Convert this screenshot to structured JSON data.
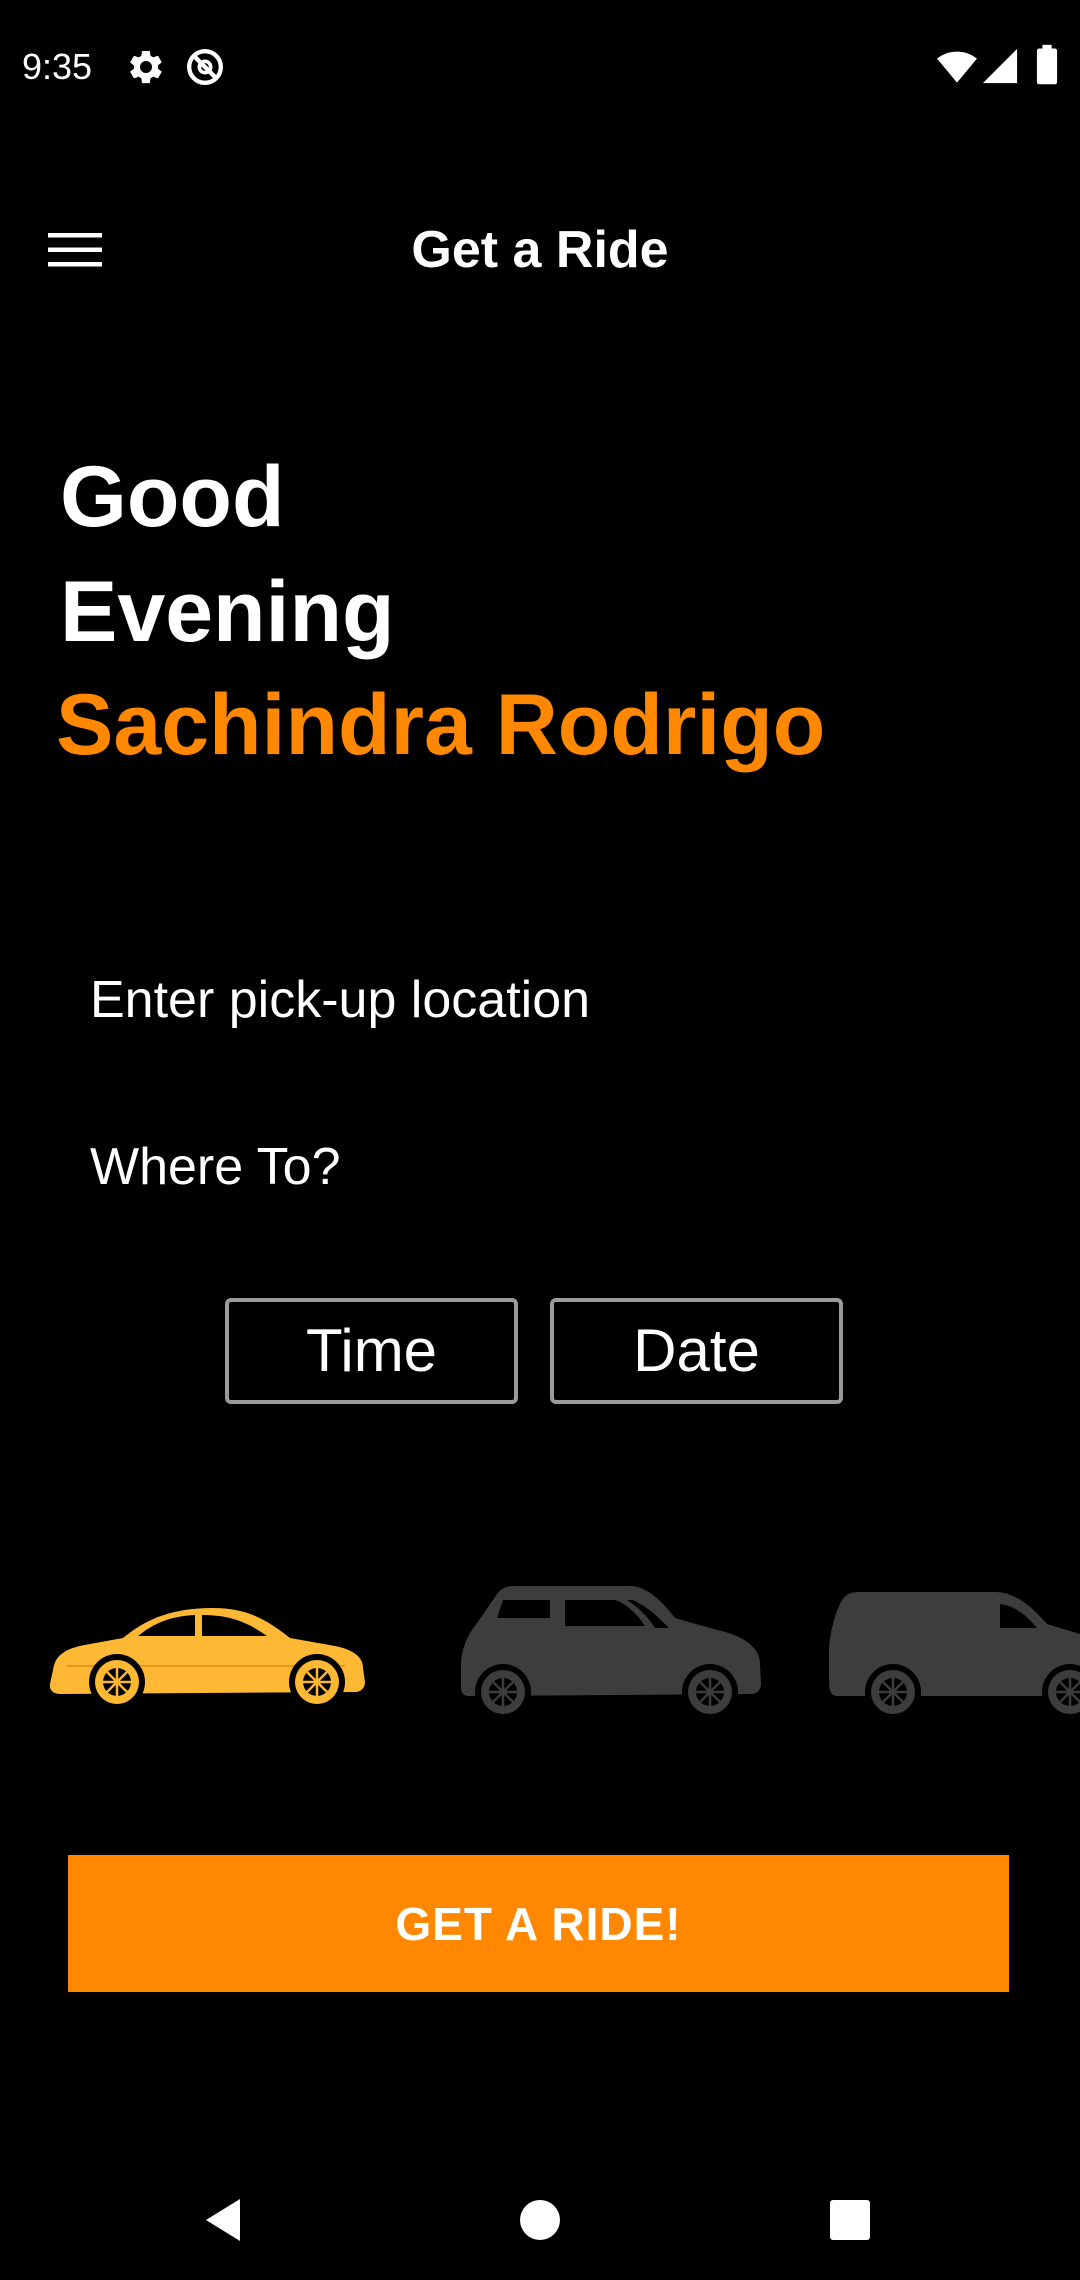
{
  "status_bar": {
    "time": "9:35",
    "icons": [
      "settings-icon",
      "do-not-disturb-icon",
      "wifi-icon",
      "cellular-signal-icon",
      "battery-icon"
    ]
  },
  "app_bar": {
    "menu_icon": "hamburger-menu-icon",
    "title": "Get a Ride"
  },
  "greeting": {
    "line1": "Good",
    "line2": "Evening",
    "user_name": "Sachindra Rodrigo"
  },
  "form": {
    "pickup_placeholder": "Enter pick-up location",
    "pickup_value": "",
    "destination_placeholder": "Where To?",
    "destination_value": "",
    "time_label": "Time",
    "date_label": "Date"
  },
  "vehicles": [
    {
      "type": "sedan",
      "selected": true,
      "icon": "sedan-car-icon"
    },
    {
      "type": "hatchback",
      "selected": false,
      "icon": "hatchback-car-icon"
    },
    {
      "type": "van",
      "selected": false,
      "icon": "van-icon"
    }
  ],
  "cta": {
    "label": "GET A RIDE!"
  },
  "colors": {
    "background": "#000000",
    "accent": "#ff8800",
    "selected_vehicle": "#ffb833",
    "unselected_vehicle": "#3d3d3d",
    "text": "#ffffff",
    "button_border": "#9a9a9a"
  },
  "nav_bar": {
    "icons": [
      "back-icon",
      "home-icon",
      "recents-icon"
    ]
  }
}
